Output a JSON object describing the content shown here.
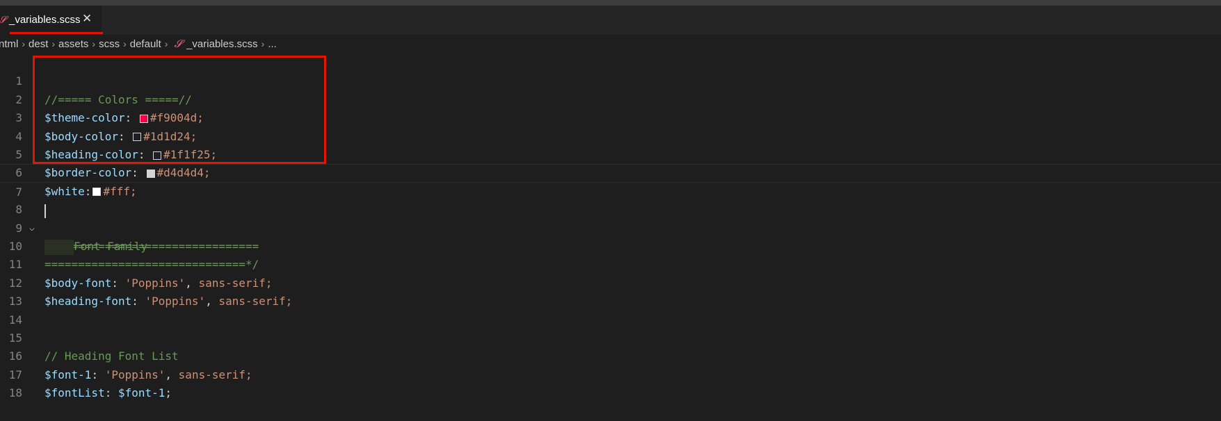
{
  "tab": {
    "icon": "sass-icon",
    "label": "_variables.scss",
    "close": "✕"
  },
  "breadcrumb": [
    "ntml",
    "dest",
    "assets",
    "scss",
    "default",
    "_variables.scss",
    "..."
  ],
  "colors": {
    "theme": "#f9004d",
    "body": "#1d1d24",
    "heading": "#1f1f25",
    "border": "#d4d4d4",
    "white": "#fff",
    "highlight": "#e51400"
  },
  "lines": [
    {
      "n": "1",
      "t": "//===== Colors =====//"
    },
    {
      "n": "2",
      "var": "$theme-color",
      "val": "#f9004d;"
    },
    {
      "n": "3",
      "var": "$body-color",
      "val": "#1d1d24;"
    },
    {
      "n": "4",
      "var": "$heading-color",
      "val": "#1f1f25;"
    },
    {
      "n": "5",
      "var": "$border-color",
      "val": "#d4d4d4;"
    },
    {
      "n": "6",
      "var": "$white",
      "val": "#fff;"
    },
    {
      "n": "7"
    },
    {
      "n": "8",
      "t": "/*=============================="
    },
    {
      "n": "9",
      "t": "Font Family"
    },
    {
      "n": "10",
      "t": "==============================*/"
    },
    {
      "n": "11",
      "var": "$body-font",
      "str": "'Poppins'",
      "rest": "sans-serif;"
    },
    {
      "n": "12",
      "var": "$heading-font",
      "str": "'Poppins'",
      "rest": "sans-serif;"
    },
    {
      "n": "13"
    },
    {
      "n": "14"
    },
    {
      "n": "15",
      "t": "// Heading Font List"
    },
    {
      "n": "16",
      "var": "$font-1",
      "str": "'Poppins'",
      "rest": "sans-serif;"
    },
    {
      "n": "17",
      "var": "$fontList",
      "ref": "$font-1",
      "end": ";"
    },
    {
      "n": "18"
    }
  ]
}
